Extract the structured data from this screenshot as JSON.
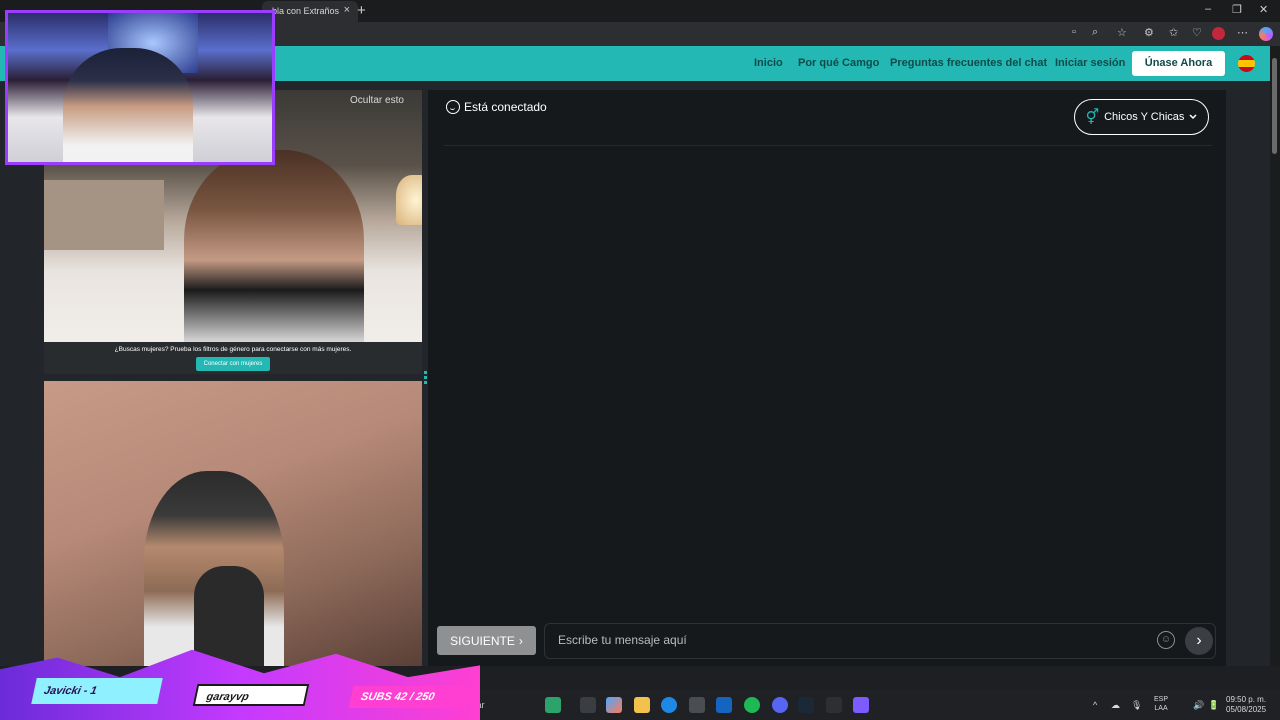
{
  "browser": {
    "tab_title": "bla con Extraños",
    "close_glyph": "×",
    "new_tab_glyph": "+",
    "window_controls": [
      "–",
      "❐",
      "✕"
    ],
    "toolbar_icons": [
      "camera-icon",
      "zoom-icon",
      "star-icon",
      "extensions-icon",
      "favorites-icon",
      "health-icon",
      "profile-icon",
      "more-icon",
      "copilot-icon"
    ],
    "toolbar_glyphs": [
      "▫",
      "⌕",
      "☆",
      "⚙",
      "✩",
      "♡",
      "⋯"
    ]
  },
  "nav": {
    "links": [
      "Inicio",
      "Por qué Camgo",
      "Preguntas frecuentes del chat",
      "Iniciar sesión"
    ],
    "join_label": "Únase Ahora"
  },
  "video": {
    "watermark": "Ocultar esto",
    "banner_text": "¿Buscas mujeres? Prueba los filtros de género para conectarse con más mujeres.",
    "banner_button": "Conectar con mujeres"
  },
  "chat": {
    "status": "Está conectado",
    "gender_filter": "Chicos Y Chicas",
    "gender_glyph": "⚥",
    "next_label": "SIGUIENTE",
    "next_glyph": "›",
    "message_placeholder": "Escribe tu mensaje aquí",
    "send_glyph": "›"
  },
  "overlay": {
    "chip_1": "Javicki - 1",
    "chip_2": "garayvp",
    "chip_3": "SUBS 42 / 250"
  },
  "taskbar": {
    "search_text": "car",
    "tray": [
      "^",
      "☁",
      "🎙",
      "🔊",
      "🔋"
    ],
    "lang_top": "ESP",
    "lang_bottom": "LAA",
    "time": "09:50 p. m.",
    "date": "05/08/2025"
  },
  "colors": {
    "accent": "#23b8b3",
    "overlay_purple": "#9b3dff",
    "overlay_pink": "#ff3fd1"
  }
}
